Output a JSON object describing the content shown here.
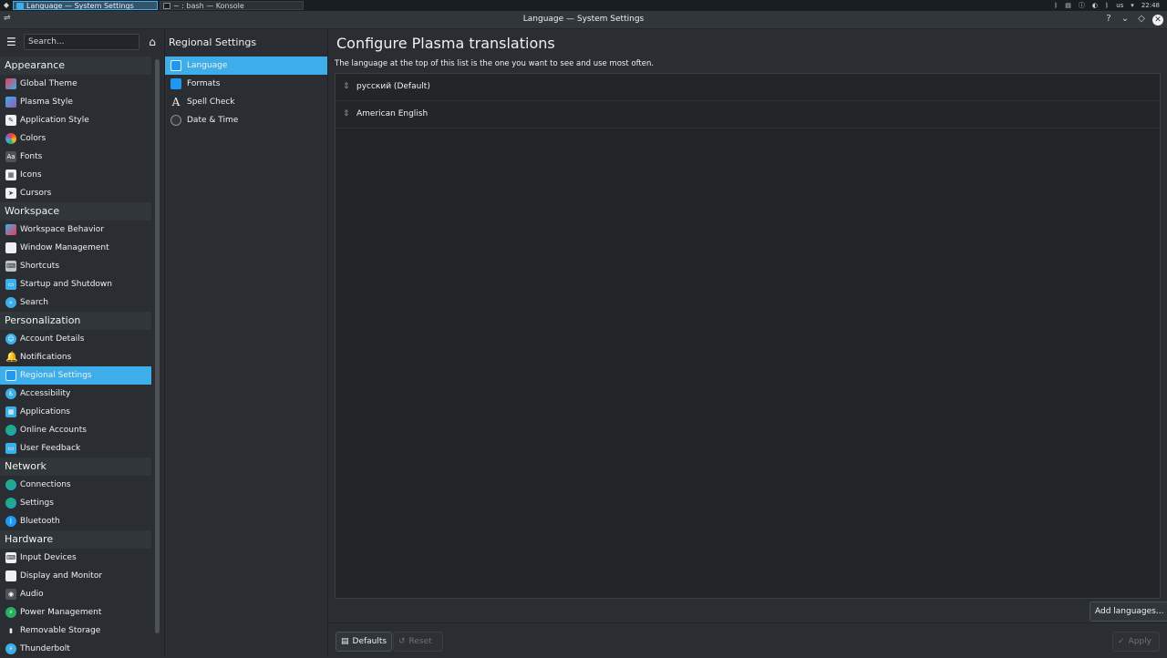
{
  "taskbar": {
    "launcher_icon": "kde-launcher-icon",
    "tasks": [
      {
        "label": "Language  — System Settings",
        "icon": "system-settings-icon",
        "active": true
      },
      {
        "label": "~ : bash — Konsole",
        "icon": "konsole-icon",
        "active": false
      }
    ],
    "tray": {
      "keyboard_layout": "us",
      "clock": "22:48"
    }
  },
  "window": {
    "title": "Language — System Settings",
    "buttons": {
      "help": "?",
      "minimize": "⌄",
      "maximize": "◇",
      "close": "✕"
    }
  },
  "sidebar": {
    "search_placeholder": "Search...",
    "categories": [
      {
        "label": "Appearance",
        "items": [
          {
            "label": "Global Theme",
            "icon": "global-theme-icon"
          },
          {
            "label": "Plasma Style",
            "icon": "plasma-style-icon"
          },
          {
            "label": "Application Style",
            "icon": "application-style-icon"
          },
          {
            "label": "Colors",
            "icon": "colors-icon"
          },
          {
            "label": "Fonts",
            "icon": "fonts-icon"
          },
          {
            "label": "Icons",
            "icon": "icons-icon"
          },
          {
            "label": "Cursors",
            "icon": "cursors-icon"
          }
        ]
      },
      {
        "label": "Workspace",
        "items": [
          {
            "label": "Workspace Behavior",
            "icon": "workspace-behavior-icon"
          },
          {
            "label": "Window Management",
            "icon": "window-management-icon"
          },
          {
            "label": "Shortcuts",
            "icon": "shortcuts-icon"
          },
          {
            "label": "Startup and Shutdown",
            "icon": "startup-shutdown-icon"
          },
          {
            "label": "Search",
            "icon": "search-icon"
          }
        ]
      },
      {
        "label": "Personalization",
        "items": [
          {
            "label": "Account Details",
            "icon": "account-details-icon"
          },
          {
            "label": "Notifications",
            "icon": "notifications-icon"
          },
          {
            "label": "Regional Settings",
            "icon": "regional-settings-icon",
            "selected": true
          },
          {
            "label": "Accessibility",
            "icon": "accessibility-icon"
          },
          {
            "label": "Applications",
            "icon": "applications-icon"
          },
          {
            "label": "Online Accounts",
            "icon": "online-accounts-icon"
          },
          {
            "label": "User Feedback",
            "icon": "user-feedback-icon"
          }
        ]
      },
      {
        "label": "Network",
        "items": [
          {
            "label": "Connections",
            "icon": "connections-icon"
          },
          {
            "label": "Settings",
            "icon": "network-settings-icon"
          },
          {
            "label": "Bluetooth",
            "icon": "bluetooth-icon"
          }
        ]
      },
      {
        "label": "Hardware",
        "items": [
          {
            "label": "Input Devices",
            "icon": "input-devices-icon"
          },
          {
            "label": "Display and Monitor",
            "icon": "display-monitor-icon"
          },
          {
            "label": "Audio",
            "icon": "audio-icon"
          },
          {
            "label": "Power Management",
            "icon": "power-management-icon"
          },
          {
            "label": "Removable Storage",
            "icon": "removable-storage-icon"
          },
          {
            "label": "Thunderbolt",
            "icon": "thunderbolt-icon"
          }
        ]
      }
    ]
  },
  "subpanel": {
    "title": "Regional Settings",
    "items": [
      {
        "label": "Language",
        "icon": "language-icon",
        "selected": true
      },
      {
        "label": "Formats",
        "icon": "formats-icon"
      },
      {
        "label": "Spell Check",
        "icon": "spell-check-icon"
      },
      {
        "label": "Date & Time",
        "icon": "date-time-icon"
      }
    ]
  },
  "content": {
    "title": "Configure Plasma translations",
    "description": "The language at the top of this list is the one you want to see and use most often.",
    "languages": [
      "русский (Default)",
      "American English"
    ],
    "add_languages_label": "Add languages...",
    "defaults_label": "Defaults",
    "reset_label": "Reset",
    "apply_label": "Apply"
  },
  "colors": {
    "accent": "#3daee9",
    "window_bg": "#2a2e32",
    "list_bg": "#232629",
    "text": "#eff0f1"
  }
}
